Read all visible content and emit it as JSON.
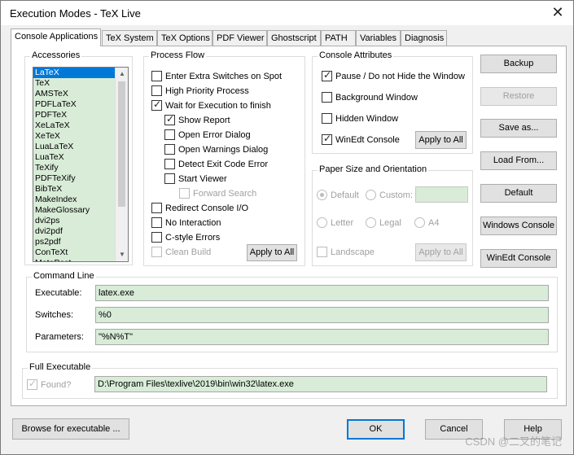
{
  "window": {
    "title": "Execution Modes - TeX Live",
    "close_glyph": "✕"
  },
  "tabs": [
    "Console Applications",
    "TeX System",
    "TeX Options",
    "PDF Viewer",
    "Ghostscript",
    "PATH",
    "Variables",
    "Diagnosis"
  ],
  "accessories": {
    "title": "Accessories",
    "items": [
      "LaTeX",
      "TeX",
      "AMSTeX",
      "PDFLaTeX",
      "PDFTeX",
      "XeLaTeX",
      "XeTeX",
      "LuaLaTeX",
      "LuaTeX",
      "TeXify",
      "PDFTeXify",
      "BibTeX",
      "MakeIndex",
      "MakeGlossary",
      "dvi2ps",
      "dvi2pdf",
      "ps2pdf",
      "ConTeXt",
      "MetaPost"
    ],
    "selected": "LaTeX"
  },
  "process_flow": {
    "title": "Process Flow",
    "extra_switches": "Enter Extra Switches on Spot",
    "high_priority": "High Priority Process",
    "wait": "Wait for Execution to finish",
    "show_report": "Show Report",
    "open_error": "Open Error Dialog",
    "open_warnings": "Open Warnings Dialog",
    "detect_exit": "Detect Exit Code Error",
    "start_viewer": "Start Viewer",
    "forward_search": "Forward Search",
    "redirect": "Redirect Console I/O",
    "no_interaction": "No Interaction",
    "c_style": "C-style Errors",
    "clean_build": "Clean Build",
    "apply": "Apply to All"
  },
  "console_attributes": {
    "title": "Console Attributes",
    "pause": "Pause / Do not Hide the Window",
    "background": "Background Window",
    "hidden": "Hidden Window",
    "winedt": "WinEdt Console",
    "apply": "Apply to All"
  },
  "paper": {
    "title": "Paper Size and Orientation",
    "default": "Default",
    "custom": "Custom:",
    "letter": "Letter",
    "legal": "Legal",
    "a4": "A4",
    "landscape": "Landscape",
    "apply": "Apply to All"
  },
  "right_buttons": {
    "backup": "Backup",
    "restore": "Restore",
    "save_as": "Save as...",
    "load_from": "Load From...",
    "default": "Default",
    "windows_console": "Windows Console",
    "winedt_console": "WinEdt Console"
  },
  "command_line": {
    "title": "Command Line",
    "executable_label": "Executable:",
    "executable": "latex.exe",
    "switches_label": "Switches:",
    "switches": "%0",
    "parameters_label": "Parameters:",
    "parameters": "\"%N%T\""
  },
  "full_executable": {
    "title": "Full Executable",
    "found": "Found?",
    "path": "D:\\Program Files\\texlive\\2019\\bin\\win32\\latex.exe"
  },
  "footer": {
    "browse": "Browse for executable ...",
    "ok": "OK",
    "cancel": "Cancel",
    "help": "Help"
  },
  "watermark": "CSDN @二叉的笔记"
}
